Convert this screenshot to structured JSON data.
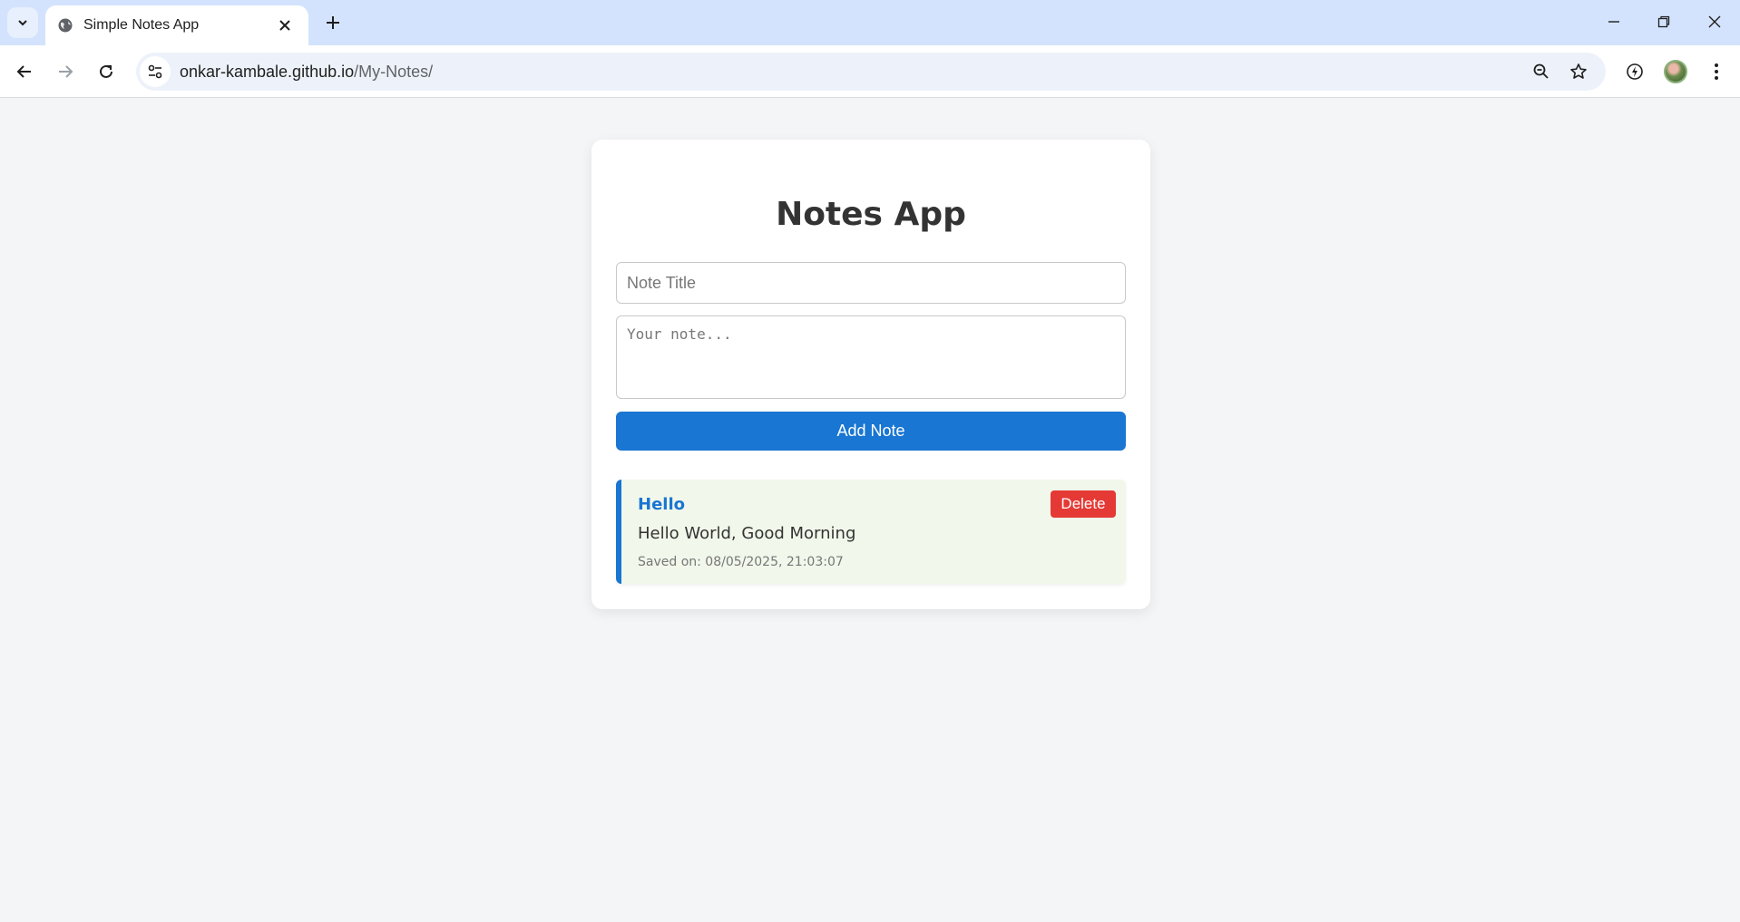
{
  "browser": {
    "tab": {
      "title": "Simple Notes App",
      "favicon": "globe-icon"
    },
    "url": {
      "host": "onkar-kambale.github.io",
      "path": "/My-Notes/"
    },
    "icons": {
      "tab_search": "chevron-down-icon",
      "tab_close": "close-icon",
      "new_tab": "plus-icon",
      "back": "arrow-left-icon",
      "forward": "arrow-right-icon",
      "reload": "reload-icon",
      "site_info": "tune-icon",
      "zoom": "zoom-out-icon",
      "bookmark": "star-icon",
      "extension": "lightning-icon",
      "profile": "avatar",
      "menu": "kebab-menu-icon",
      "minimize": "minimize-icon",
      "restore": "restore-icon",
      "close_window": "close-icon"
    }
  },
  "app": {
    "title": "Notes App",
    "title_placeholder": "Note Title",
    "note_placeholder": "Your note...",
    "add_button": "Add Note",
    "colors": {
      "accent": "#1976d2",
      "danger": "#e53935",
      "note_bg": "#f1f7ea",
      "page_bg": "#f4f5f7"
    }
  },
  "notes": [
    {
      "title": "Hello",
      "body": "Hello World, Good Morning",
      "saved": "Saved on: 08/05/2025, 21:03:07",
      "delete_label": "Delete"
    }
  ]
}
